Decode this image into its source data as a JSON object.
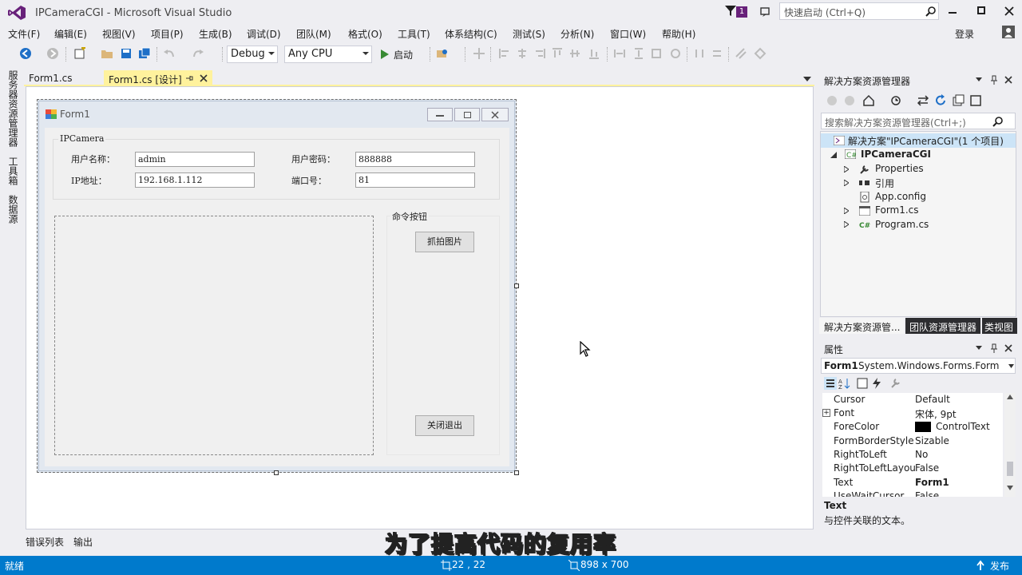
{
  "window": {
    "title": "IPCameraCGI - Microsoft Visual Studio"
  },
  "titlebar": {
    "quick_launch_placeholder": "快速启动 (Ctrl+Q)",
    "notification_count": "1"
  },
  "menu": [
    "文件(F)",
    "编辑(E)",
    "视图(V)",
    "项目(P)",
    "生成(B)",
    "调试(D)",
    "团队(M)",
    "格式(O)",
    "工具(T)",
    "体系结构(C)",
    "测试(S)",
    "分析(N)",
    "窗口(W)",
    "帮助(H)"
  ],
  "signin": "登录",
  "toolbar": {
    "config": "Debug",
    "platform": "Any CPU",
    "start_label": "启动"
  },
  "left_tabs": [
    "服务器资源管理器",
    "工具箱",
    "数据源"
  ],
  "doc_tabs": [
    {
      "label": "Form1.cs"
    },
    {
      "label": "Form1.cs [设计]"
    }
  ],
  "form": {
    "title": "Form1",
    "group_title": "IPCamera",
    "username_label": "用户名称：",
    "username_value": "admin",
    "password_label": "用户密码：",
    "password_value": "888888",
    "ip_label": "IP地址：",
    "ip_value": "192.168.1.112",
    "port_label": "端口号：",
    "port_value": "81",
    "cmd_group_title": "命令按钮",
    "snapshot_button": "抓拍图片",
    "close_button": "关闭退出"
  },
  "solution_explorer": {
    "title": "解决方案资源管理器",
    "search_placeholder": "搜索解决方案资源管理器(Ctrl+;)",
    "solution": "解决方案\"IPCameraCGI\"(1 个项目)",
    "project": "IPCameraCGI",
    "items": [
      "Properties",
      "引用",
      "App.config",
      "Form1.cs",
      "Program.cs"
    ],
    "bottom_tabs": [
      "解决方案资源管...",
      "团队资源管理器",
      "类视图"
    ]
  },
  "properties": {
    "title": "属性",
    "object": "Form1",
    "object_type": "System.Windows.Forms.Form",
    "rows": [
      {
        "name": "Cursor",
        "value": "Default"
      },
      {
        "name": "Font",
        "value": "宋体, 9pt"
      },
      {
        "name": "ForeColor",
        "value": "ControlText"
      },
      {
        "name": "FormBorderStyle",
        "value": "Sizable"
      },
      {
        "name": "RightToLeft",
        "value": "No"
      },
      {
        "name": "RightToLeftLayou",
        "value": "False"
      },
      {
        "name": "Text",
        "value": "Form1"
      },
      {
        "name": "UseWaitCursor",
        "value": "False"
      }
    ],
    "desc_title": "Text",
    "desc_text": "与控件关联的文本。"
  },
  "bottom_tabs": [
    "错误列表",
    "输出"
  ],
  "status": {
    "ready": "就绪",
    "position": "22 , 22",
    "size": "898 x 700",
    "publish": "发布"
  },
  "subtitle": "为了提高代码的复用率",
  "colors": {
    "accent": "#007acc",
    "active_tab": "#fff29d"
  }
}
